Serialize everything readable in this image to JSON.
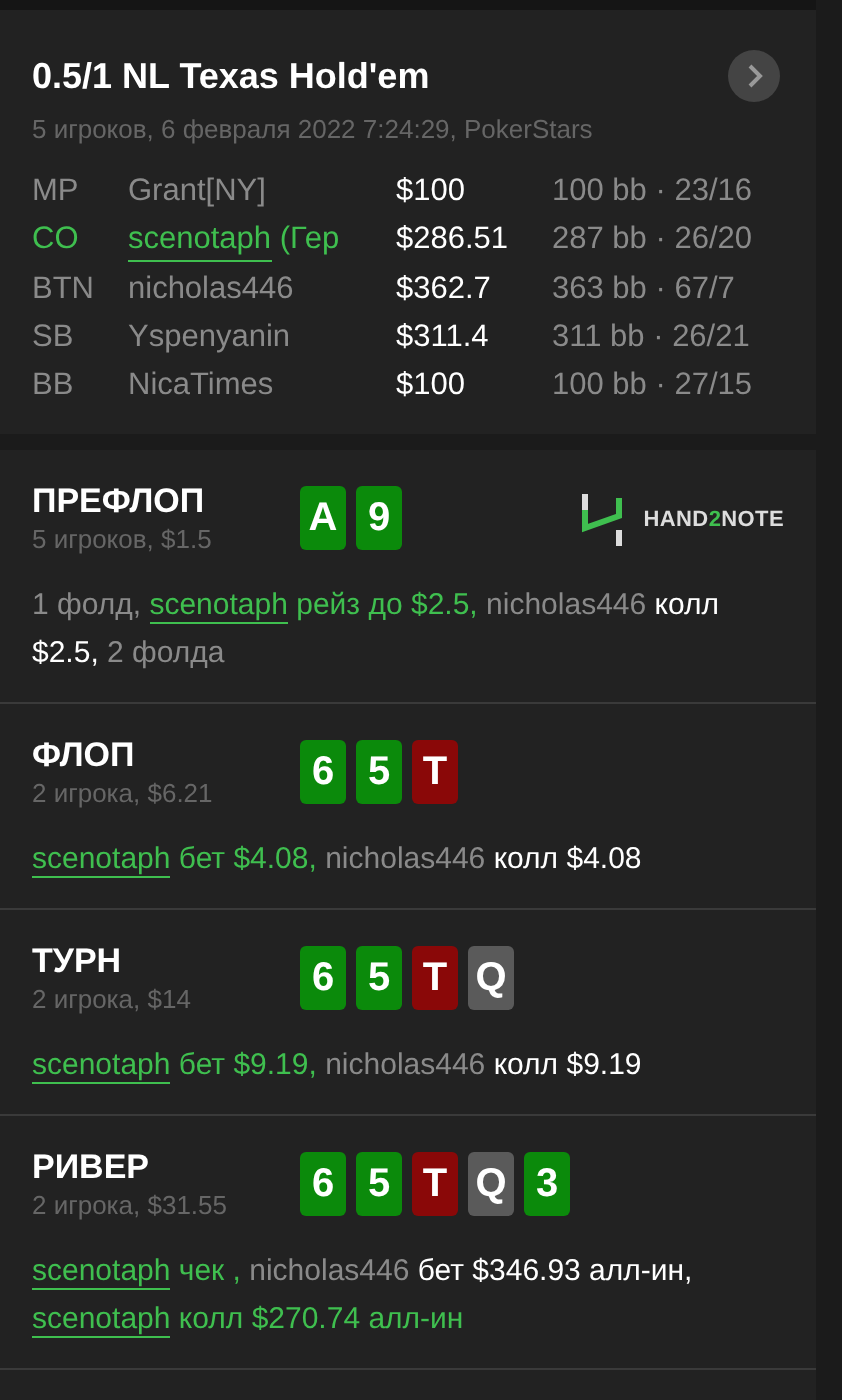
{
  "hand": {
    "title": "0.5/1 NL Texas Hold'em",
    "subtitle": "5 игроков, 6 февраля 2022 7:24:29, PokerStars"
  },
  "players": [
    {
      "position": "MP",
      "name": "Grant[NY]",
      "hero": false,
      "stack": "$100",
      "bb": "100 bb",
      "sep": "·",
      "stats": "23/16"
    },
    {
      "position": "CO",
      "name": "scenotaph",
      "note": "(Гер",
      "hero": true,
      "stack": "$286.51",
      "bb": "287 bb",
      "sep": "·",
      "stats": "26/20"
    },
    {
      "position": "BTN",
      "name": "nicholas446",
      "hero": false,
      "stack": "$362.7",
      "bb": "363 bb",
      "sep": "·",
      "stats": "67/7"
    },
    {
      "position": "SB",
      "name": "Yspenyanin",
      "hero": false,
      "stack": "$311.4",
      "bb": "311 bb",
      "sep": "·",
      "stats": "26/21"
    },
    {
      "position": "BB",
      "name": "NicaTimes",
      "hero": false,
      "stack": "$100",
      "bb": "100 bb",
      "sep": "·",
      "stats": "27/15"
    }
  ],
  "logo": {
    "parts": [
      {
        "text": "HAND",
        "accent": false
      },
      {
        "text": "2",
        "accent": true
      },
      {
        "text": "NOTE",
        "accent": false
      }
    ]
  },
  "streets": [
    {
      "name": "ПРЕФЛОП",
      "info": "5 игроков, $1.5",
      "logo": true,
      "cards": [
        {
          "rank": "A",
          "color": "#0b8a0b"
        },
        {
          "rank": "9",
          "color": "#0b8a0b"
        }
      ],
      "actions": [
        {
          "kind": "muted",
          "text": "1 фолд, "
        },
        {
          "kind": "hero",
          "text": "scenotaph"
        },
        {
          "kind": "hero-action",
          "text": " рейз до $2.5, "
        },
        {
          "kind": "muted",
          "text": "nicholas446 "
        },
        {
          "kind": "action",
          "text": "колл $2.5, "
        },
        {
          "kind": "muted",
          "text": "2 фолда"
        }
      ]
    },
    {
      "name": "ФЛОП",
      "info": "2 игрока, $6.21",
      "logo": false,
      "cards": [
        {
          "rank": "6",
          "color": "#0b8a0b"
        },
        {
          "rank": "5",
          "color": "#0b8a0b"
        },
        {
          "rank": "T",
          "color": "#8a0808"
        }
      ],
      "actions": [
        {
          "kind": "hero",
          "text": "scenotaph"
        },
        {
          "kind": "hero-action",
          "text": " бет $4.08, "
        },
        {
          "kind": "muted",
          "text": "nicholas446 "
        },
        {
          "kind": "action",
          "text": "колл $4.08"
        }
      ]
    },
    {
      "name": "ТУРН",
      "info": "2 игрока, $14",
      "logo": false,
      "cards": [
        {
          "rank": "6",
          "color": "#0b8a0b"
        },
        {
          "rank": "5",
          "color": "#0b8a0b"
        },
        {
          "rank": "T",
          "color": "#8a0808"
        },
        {
          "rank": "Q",
          "color": "#5a5a5a"
        }
      ],
      "actions": [
        {
          "kind": "hero",
          "text": "scenotaph"
        },
        {
          "kind": "hero-action",
          "text": " бет $9.19, "
        },
        {
          "kind": "muted",
          "text": "nicholas446 "
        },
        {
          "kind": "action",
          "text": "колл $9.19"
        }
      ]
    },
    {
      "name": "РИВЕР",
      "info": "2 игрока, $31.55",
      "logo": false,
      "cards": [
        {
          "rank": "6",
          "color": "#0b8a0b"
        },
        {
          "rank": "5",
          "color": "#0b8a0b"
        },
        {
          "rank": "T",
          "color": "#8a0808"
        },
        {
          "rank": "Q",
          "color": "#5a5a5a"
        },
        {
          "rank": "3",
          "color": "#0b8a0b"
        }
      ],
      "actions": [
        {
          "kind": "hero",
          "text": "scenotaph"
        },
        {
          "kind": "hero-action",
          "text": " чек , "
        },
        {
          "kind": "muted",
          "text": "nicholas446 "
        },
        {
          "kind": "action",
          "text": "бет $346.93 алл-ин, "
        },
        {
          "kind": "hero",
          "text": "scenotaph"
        },
        {
          "kind": "hero-action",
          "text": " колл $270.74 алл-ин"
        }
      ]
    }
  ]
}
